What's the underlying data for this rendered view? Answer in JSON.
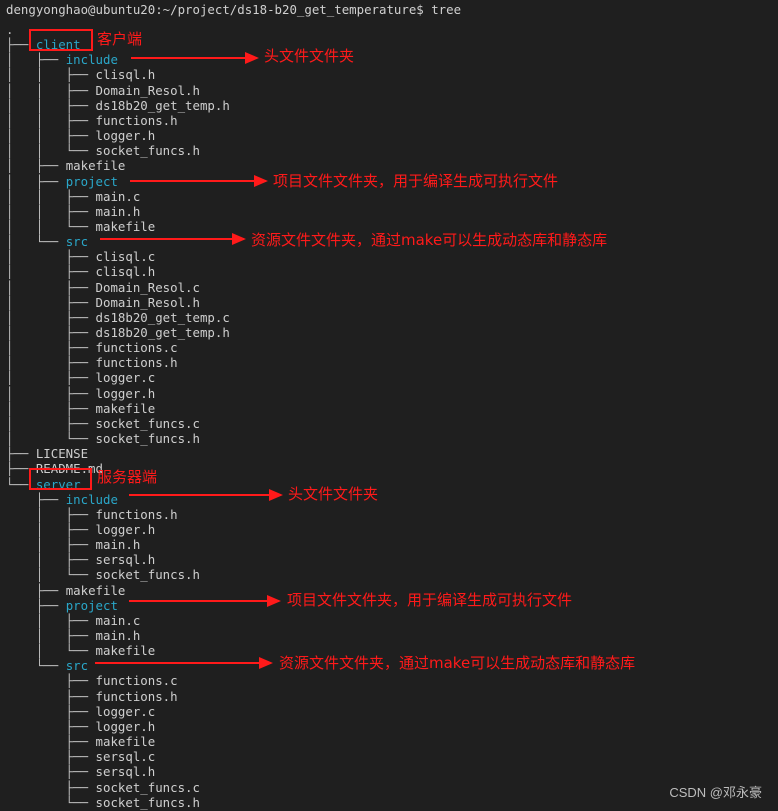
{
  "terminal": {
    "prompt": "dengyonghao@ubuntu20:~/project/ds18-b20_get_temperature$ tree",
    "tree": [
      {
        "prefix": ".",
        "name": "",
        "type": "root"
      },
      {
        "prefix": "├── ",
        "name": "client",
        "type": "dir"
      },
      {
        "prefix": "│   ├── ",
        "name": "include",
        "type": "dir"
      },
      {
        "prefix": "│   │   ├── ",
        "name": "clisql.h",
        "type": "file"
      },
      {
        "prefix": "│   │   ├── ",
        "name": "Domain_Resol.h",
        "type": "file"
      },
      {
        "prefix": "│   │   ├── ",
        "name": "ds18b20_get_temp.h",
        "type": "file"
      },
      {
        "prefix": "│   │   ├── ",
        "name": "functions.h",
        "type": "file"
      },
      {
        "prefix": "│   │   ├── ",
        "name": "logger.h",
        "type": "file"
      },
      {
        "prefix": "│   │   └── ",
        "name": "socket_funcs.h",
        "type": "file"
      },
      {
        "prefix": "│   ├── ",
        "name": "makefile",
        "type": "file"
      },
      {
        "prefix": "│   ├── ",
        "name": "project",
        "type": "dir"
      },
      {
        "prefix": "│   │   ├── ",
        "name": "main.c",
        "type": "file"
      },
      {
        "prefix": "│   │   ├── ",
        "name": "main.h",
        "type": "file"
      },
      {
        "prefix": "│   │   └── ",
        "name": "makefile",
        "type": "file"
      },
      {
        "prefix": "│   └── ",
        "name": "src",
        "type": "dir"
      },
      {
        "prefix": "│       ├── ",
        "name": "clisql.c",
        "type": "file"
      },
      {
        "prefix": "│       ├── ",
        "name": "clisql.h",
        "type": "file"
      },
      {
        "prefix": "│       ├── ",
        "name": "Domain_Resol.c",
        "type": "file"
      },
      {
        "prefix": "│       ├── ",
        "name": "Domain_Resol.h",
        "type": "file"
      },
      {
        "prefix": "│       ├── ",
        "name": "ds18b20_get_temp.c",
        "type": "file"
      },
      {
        "prefix": "│       ├── ",
        "name": "ds18b20_get_temp.h",
        "type": "file"
      },
      {
        "prefix": "│       ├── ",
        "name": "functions.c",
        "type": "file"
      },
      {
        "prefix": "│       ├── ",
        "name": "functions.h",
        "type": "file"
      },
      {
        "prefix": "│       ├── ",
        "name": "logger.c",
        "type": "file"
      },
      {
        "prefix": "│       ├── ",
        "name": "logger.h",
        "type": "file"
      },
      {
        "prefix": "│       ├── ",
        "name": "makefile",
        "type": "file"
      },
      {
        "prefix": "│       ├── ",
        "name": "socket_funcs.c",
        "type": "file"
      },
      {
        "prefix": "│       └── ",
        "name": "socket_funcs.h",
        "type": "file"
      },
      {
        "prefix": "├── ",
        "name": "LICENSE",
        "type": "file"
      },
      {
        "prefix": "├── ",
        "name": "README.md",
        "type": "file"
      },
      {
        "prefix": "└── ",
        "name": "server",
        "type": "dir"
      },
      {
        "prefix": "    ├── ",
        "name": "include",
        "type": "dir"
      },
      {
        "prefix": "    │   ├── ",
        "name": "functions.h",
        "type": "file"
      },
      {
        "prefix": "    │   ├── ",
        "name": "logger.h",
        "type": "file"
      },
      {
        "prefix": "    │   ├── ",
        "name": "main.h",
        "type": "file"
      },
      {
        "prefix": "    │   ├── ",
        "name": "sersql.h",
        "type": "file"
      },
      {
        "prefix": "    │   └── ",
        "name": "socket_funcs.h",
        "type": "file"
      },
      {
        "prefix": "    ├── ",
        "name": "makefile",
        "type": "file"
      },
      {
        "prefix": "    ├── ",
        "name": "project",
        "type": "dir"
      },
      {
        "prefix": "    │   ├── ",
        "name": "main.c",
        "type": "file"
      },
      {
        "prefix": "    │   ├── ",
        "name": "main.h",
        "type": "file"
      },
      {
        "prefix": "    │   └── ",
        "name": "makefile",
        "type": "file"
      },
      {
        "prefix": "    └── ",
        "name": "src",
        "type": "dir"
      },
      {
        "prefix": "        ├── ",
        "name": "functions.c",
        "type": "file"
      },
      {
        "prefix": "        ├── ",
        "name": "functions.h",
        "type": "file"
      },
      {
        "prefix": "        ├── ",
        "name": "logger.c",
        "type": "file"
      },
      {
        "prefix": "        ├── ",
        "name": "logger.h",
        "type": "file"
      },
      {
        "prefix": "        ├── ",
        "name": "makefile",
        "type": "file"
      },
      {
        "prefix": "        ├── ",
        "name": "sersql.c",
        "type": "file"
      },
      {
        "prefix": "        ├── ",
        "name": "sersql.h",
        "type": "file"
      },
      {
        "prefix": "        ├── ",
        "name": "socket_funcs.c",
        "type": "file"
      },
      {
        "prefix": "        └── ",
        "name": "socket_funcs.h",
        "type": "file"
      }
    ]
  },
  "annotations": {
    "client_label": "客户端",
    "client_include": "头文件文件夹",
    "client_project": "项目文件文件夹，用于编译生成可执行文件",
    "client_src": "资源文件文件夹，通过make可以生成动态库和静态库",
    "server_label": "服务器端",
    "server_include": "头文件文件夹",
    "server_project": "项目文件文件夹，用于编译生成可执行文件",
    "server_src": "资源文件文件夹，通过make可以生成动态库和静态库"
  },
  "colors": {
    "background": "#1f1f1f",
    "text": "#cfcfcf",
    "directory": "#2aa7c9",
    "annotation": "#ff1a1a"
  },
  "watermark": "CSDN @邓永豪"
}
